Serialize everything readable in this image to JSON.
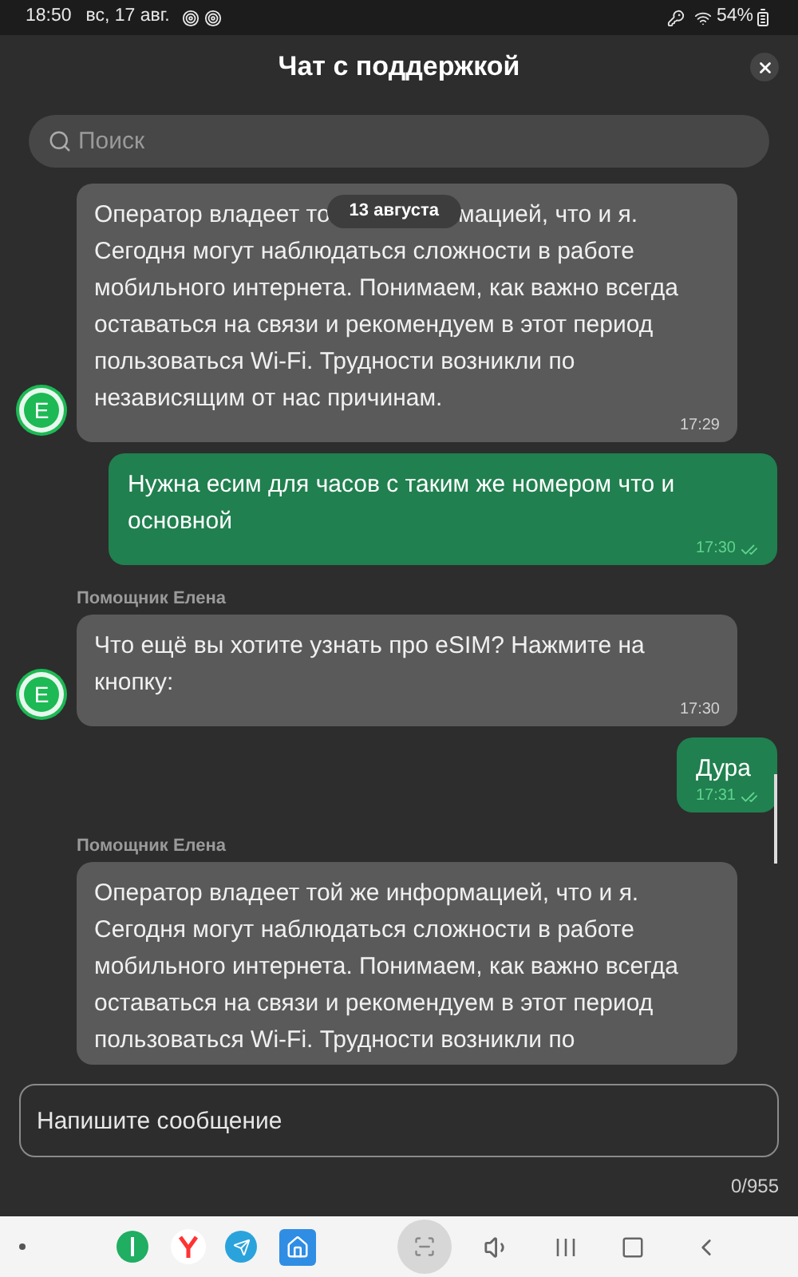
{
  "status_bar": {
    "time": "18:50",
    "date": "вс, 17 авг.",
    "battery": "54%"
  },
  "header": {
    "title": "Чат с поддержкой"
  },
  "search": {
    "placeholder": "Поиск"
  },
  "messages": [
    {
      "kind": "incoming",
      "avatar": "Е",
      "text_parts": [
        "Оператор владеет то",
        "мацией, что и я.",
        "Сегодня могут наблюдаться сложности в работе мобильного интернета. Понимаем, как важно всегда оставаться на связи и рекомендуем в этот период пользоваться Wi-Fi. Трудности возникли по независящим от нас причинам."
      ],
      "date_chip": "13 августа",
      "time": "17:29"
    },
    {
      "kind": "outgoing",
      "text_parts": [
        "Нужна есим для часов с таким же номером что и основной"
      ],
      "time": "17:30",
      "read": true
    },
    {
      "kind": "incoming",
      "avatar": "Е",
      "sender": "Помощник Елена",
      "text_parts": [
        "Что ещё вы хотите узнать про eSIM? Нажмите на кнопку:"
      ],
      "time": "17:30"
    },
    {
      "kind": "outgoing",
      "text_parts": [
        "Дура"
      ],
      "time": "17:31",
      "read": true
    },
    {
      "kind": "incoming",
      "sender": "Помощник Елена",
      "text_parts": [
        "Оператор владеет той же информацией, что и я. Сегодня могут наблюдаться сложности в работе мобильного интернета. Понимаем, как важно всегда оставаться на связи и рекомендуем в этот период пользоваться Wi-Fi. Трудности возникли по"
      ]
    }
  ],
  "composer": {
    "placeholder": "Напишите сообщение",
    "counter": "0/955"
  }
}
